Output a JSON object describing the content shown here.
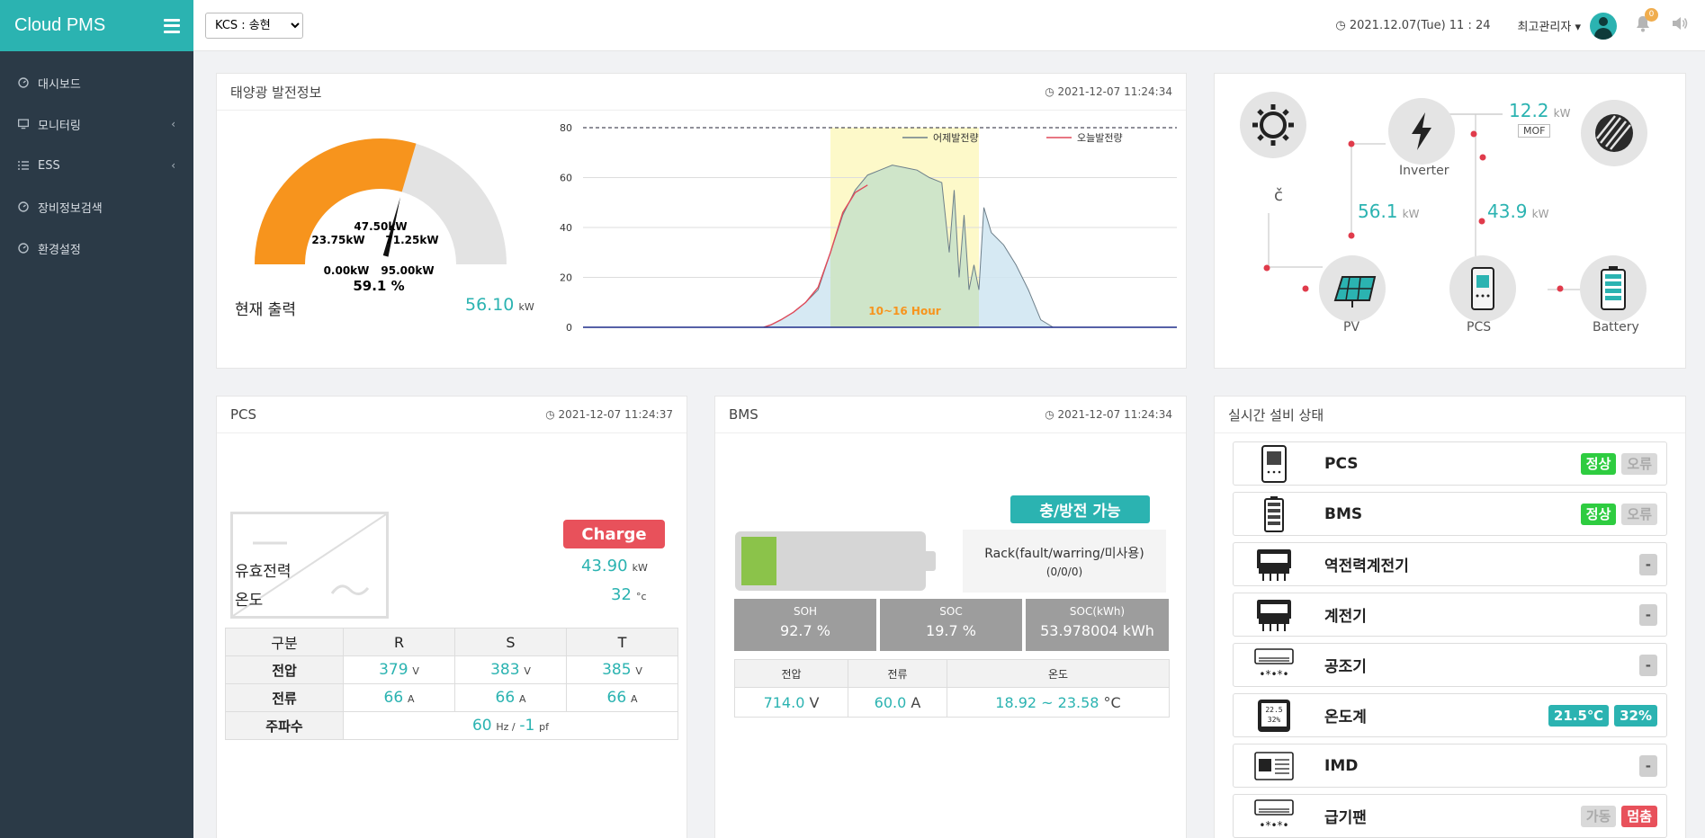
{
  "sidebar": {
    "brand": "Cloud PMS",
    "items": [
      {
        "label": "대시보드",
        "icon": "dashboard-icon"
      },
      {
        "label": "모니터링",
        "icon": "monitor-icon",
        "chevron": "‹"
      },
      {
        "label": "ESS",
        "icon": "list-icon",
        "chevron": "‹"
      },
      {
        "label": "장비정보검색",
        "icon": "dashboard-icon"
      },
      {
        "label": "환경설정",
        "icon": "dashboard-icon"
      }
    ]
  },
  "topbar": {
    "site_select": "KCS : 송현",
    "datetime": "2021.12.07(Tue) 11 : 24",
    "user": "최고관리자",
    "notification_count": "0"
  },
  "solar": {
    "title": "태양광 발전정보",
    "timestamp": "2021-12-07 11:24:34",
    "gauge": {
      "percent": 59.1,
      "percent_label": "59.1 %",
      "min_label": "0.00kW",
      "max_label": "95.00kW",
      "mid_label": "47.50kW",
      "q1_label": "23.75kW",
      "q3_label": "71.25kW",
      "fill_color": "#f7941d",
      "rest_color": "#e3e3e3"
    },
    "output_label": "현재 출력",
    "output_value": "56.10",
    "output_unit": "kW"
  },
  "chart_data": {
    "type": "area",
    "title": "",
    "xlabel": "",
    "ylabel": "",
    "ylim": [
      0,
      80
    ],
    "yticks": [
      0,
      20,
      40,
      60,
      80
    ],
    "x_hours_range": [
      0,
      24
    ],
    "reference_line": 80,
    "highlight_window": {
      "from_hour": 10,
      "to_hour": 16,
      "label": "10~16 Hour",
      "color": "#fdf9c9"
    },
    "legend_position": "top-right",
    "series": [
      {
        "name": "어제발전량",
        "color": "#6d7f8a",
        "fill": "#cfe5f1",
        "x": [
          7.3,
          7.6,
          8.0,
          8.5,
          9.0,
          9.5,
          10.0,
          10.5,
          11.0,
          11.5,
          12.0,
          12.5,
          13.0,
          13.5,
          14.0,
          14.5,
          14.8,
          15.0,
          15.2,
          15.4,
          15.6,
          15.8,
          16.0,
          16.2,
          16.5,
          17.0,
          17.5,
          18.0,
          18.5,
          19.0
        ],
        "values": [
          0,
          1,
          3,
          6,
          10,
          15,
          30,
          45,
          55,
          61,
          63,
          65,
          64,
          63,
          60,
          58,
          30,
          55,
          20,
          45,
          15,
          25,
          15,
          48,
          38,
          33,
          25,
          15,
          3,
          0
        ]
      },
      {
        "name": "오늘발전량",
        "color": "#e04a5a",
        "x": [
          7.3,
          7.6,
          8.0,
          8.5,
          9.0,
          9.5,
          10.0,
          10.5,
          11.0,
          11.5
        ],
        "values": [
          0,
          1,
          3,
          6,
          10,
          16,
          30,
          46,
          54,
          57
        ]
      }
    ]
  },
  "diagram": {
    "grid_power": "12.2",
    "grid_unit": "kW",
    "mof_label": "MOF",
    "pv_power": "56.1",
    "pv_unit": "kW",
    "pcs_power": "43.9",
    "pcs_unit": "kW",
    "inverter_label": "Inverter",
    "pv_label": "PV",
    "pcs_label": "PCS",
    "battery_label": "Battery"
  },
  "pcs": {
    "title": "PCS",
    "timestamp": "2021-12-07 11:24:37",
    "mode": "Charge",
    "active_power_label": "유효전력",
    "active_power_value": "43.90",
    "active_power_unit": "kW",
    "temp_label": "온도",
    "temp_value": "32",
    "temp_unit": "°c",
    "table": {
      "headers": [
        "구분",
        "R",
        "S",
        "T"
      ],
      "voltage_label": "전압",
      "voltage": [
        "379",
        "383",
        "385"
      ],
      "voltage_unit": "V",
      "current_label": "전류",
      "current": [
        "66",
        "66",
        "66"
      ],
      "current_unit": "A",
      "freq_label": "주파수",
      "freq_value": "60",
      "freq_unit": "Hz /",
      "pf_value": "-1",
      "pf_unit": "pf"
    }
  },
  "bms": {
    "title": "BMS",
    "timestamp": "2021-12-07 11:24:34",
    "status": "충/방전 가능",
    "rack_label": "Rack(fault/warring/미사용)",
    "rack_value": "(0/0/0)",
    "charge_level": 0.197,
    "soh_label": "SOH",
    "soh_value": "92.7 %",
    "soc_label": "SOC",
    "soc_value": "19.7 %",
    "sockwh_label": "SOC(kWh)",
    "sockwh_value": "53.978004 kWh",
    "voltage_label": "전압",
    "voltage_value": "714.0",
    "voltage_unit": "V",
    "current_label": "전류",
    "current_value": "60.0",
    "current_unit": "A",
    "temp_label": "온도",
    "temp_value": "18.92 ~ 23.58",
    "temp_unit": "°C"
  },
  "status": {
    "title": "실시간 설비 상태",
    "rows": [
      {
        "name": "PCS",
        "icon": "pcs-device-icon",
        "badges": [
          "정상",
          "오류"
        ]
      },
      {
        "name": "BMS",
        "icon": "bms-battery-icon",
        "badges": [
          "정상",
          "오류"
        ]
      },
      {
        "name": "역전력계전기",
        "icon": "relay-icon",
        "badges": [
          "-"
        ]
      },
      {
        "name": "계전기",
        "icon": "relay-icon",
        "badges": [
          "-"
        ]
      },
      {
        "name": "공조기",
        "icon": "aircon-icon",
        "badges": [
          "-"
        ]
      },
      {
        "name": "온도계",
        "icon": "thermometer-icon",
        "badges": [
          "21.5℃",
          "32%"
        ]
      },
      {
        "name": "IMD",
        "icon": "imd-icon",
        "badges": [
          "-"
        ]
      },
      {
        "name": "급기팬",
        "icon": "aircon-icon",
        "badges": [
          "가동",
          "멈춤"
        ]
      }
    ]
  }
}
